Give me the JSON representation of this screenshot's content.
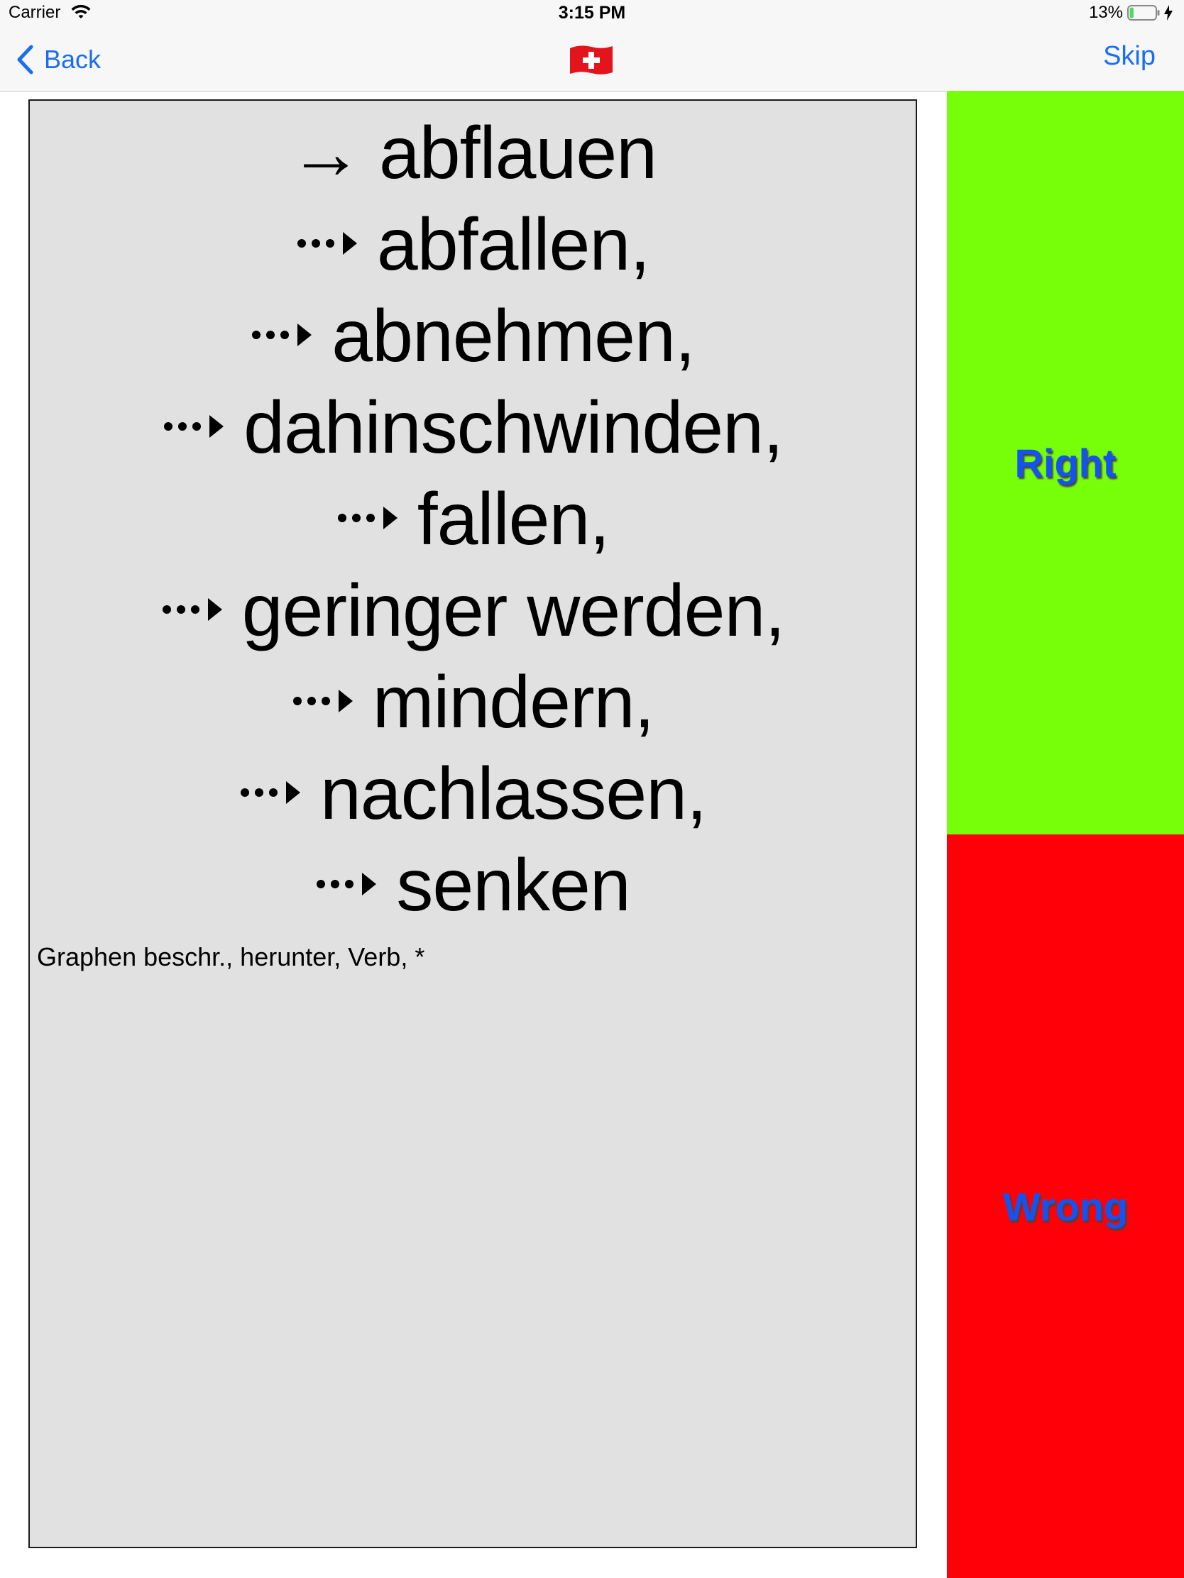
{
  "status_bar": {
    "carrier": "Carrier",
    "time": "3:15 PM",
    "battery_percent": "13%",
    "battery_level": 0.13
  },
  "nav": {
    "back_label": "Back",
    "skip_label": "Skip",
    "flag_icon": "swiss-flag-icon"
  },
  "card": {
    "headword": "abflauen",
    "synonyms": [
      "abfallen,",
      "abnehmen,",
      "dahinschwinden,",
      "fallen,",
      "geringer werden,",
      "mindern,",
      "nachlassen,",
      "senken"
    ],
    "footer": "Graphen beschr., herunter, Verb, *"
  },
  "answers": {
    "right_label": "Right",
    "wrong_label": "Wrong",
    "right_color": "#77ff0a",
    "wrong_color": "#ff0008"
  }
}
